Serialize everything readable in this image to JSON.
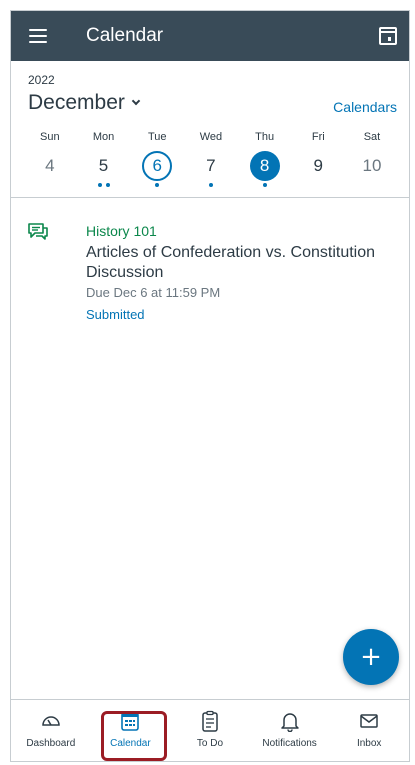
{
  "header": {
    "title": "Calendar"
  },
  "calendar": {
    "year": "2022",
    "month": "December",
    "calendars_link": "Calendars",
    "days": [
      {
        "dow": "Sun",
        "num": "4"
      },
      {
        "dow": "Mon",
        "num": "5"
      },
      {
        "dow": "Tue",
        "num": "6"
      },
      {
        "dow": "Wed",
        "num": "7"
      },
      {
        "dow": "Thu",
        "num": "8"
      },
      {
        "dow": "Fri",
        "num": "9"
      },
      {
        "dow": "Sat",
        "num": "10"
      }
    ]
  },
  "event": {
    "course": "History 101",
    "title": "Articles of Confederation vs. Constitution Discussion",
    "due": "Due Dec 6 at 11:59 PM",
    "status": "Submitted"
  },
  "fab": {
    "label": "+"
  },
  "tabs": [
    {
      "label": "Dashboard"
    },
    {
      "label": "Calendar"
    },
    {
      "label": "To Do"
    },
    {
      "label": "Notifications"
    },
    {
      "label": "Inbox"
    }
  ],
  "colors": {
    "header_bg": "#394b58",
    "accent": "#0374b5",
    "course_green": "#0b874b",
    "highlight": "#9b1c24"
  }
}
